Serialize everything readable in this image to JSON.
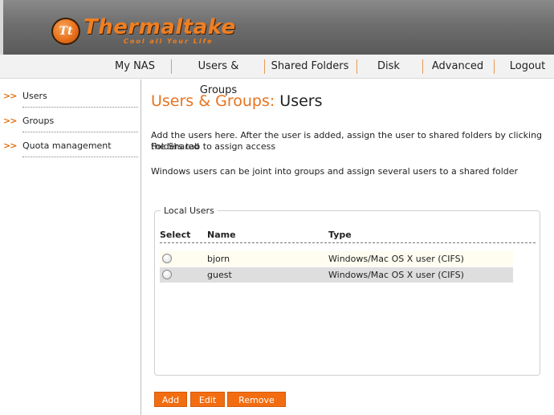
{
  "header": {
    "brand": "Thermaltake",
    "badge": "Tt",
    "tagline": "Cool all Your Life"
  },
  "nav": [
    "My NAS",
    "Users & Groups",
    "Shared Folders",
    "Disk",
    "Advanced",
    "Logout"
  ],
  "sidebar": {
    "arrow": ">>",
    "items": [
      "Users",
      "Groups",
      "Quota management"
    ]
  },
  "page": {
    "title_prefix": "Users & Groups:",
    "title_suffix": "Users",
    "desc1_line1": "Add the users here. After the user is added, assign the user to shared folders by clicking the Shared",
    "desc1_line2": "Folders tab to assign access",
    "desc2": "Windows users can be joint into groups and assign several users to a shared folder"
  },
  "local_users": {
    "legend": "Local Users",
    "headers": [
      "Select",
      "Name",
      "Type"
    ],
    "rows": [
      {
        "name": "bjorn",
        "type": "Windows/Mac OS X user (CIFS)"
      },
      {
        "name": "guest",
        "type": "Windows/Mac OS X user (CIFS)"
      }
    ]
  },
  "buttons": [
    "Add",
    "Edit",
    "Remove"
  ],
  "colors": {
    "accent": "#e8731e",
    "button": "#f26d12"
  }
}
